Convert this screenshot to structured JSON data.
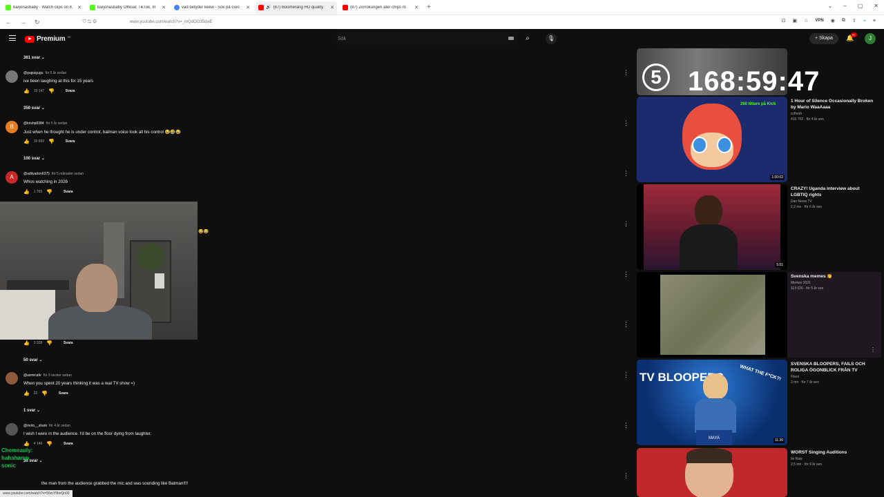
{
  "browser": {
    "tabs": [
      {
        "label": "barjonasbaby - Watch clips on K",
        "fav": "#53fc18"
      },
      {
        "label": "barjonasbaby Official: TikTok, In",
        "fav": "#53fc18"
      },
      {
        "label": "vad betyder kekw - Sök på Goo",
        "fav": "#4285f4"
      },
      {
        "label": "(87) Boomerang HD quality",
        "fav": "#ff0000"
      },
      {
        "label": "(87) Zorrokungen äter chips m",
        "fav": "#ff0000"
      }
    ],
    "url": "www.youtube.com/watch?v=_mQdOO35dwE",
    "vpn": "VPN"
  },
  "header": {
    "logo": "Premium",
    "region": "SE",
    "search_placeholder": "Sök",
    "create_label": "Skapa",
    "notif_count": "9+",
    "avatar_letter": "J"
  },
  "comments": {
    "reply_label": "Svara",
    "items": [
      {
        "replies": "361 svar"
      },
      {
        "author": "@guguigugu",
        "time": "för 5 år sedan",
        "text": "ive been laughing at this for 15 years",
        "likes": "19 147",
        "replies": "350 svar",
        "avatar_letter": ""
      },
      {
        "author": "@krishp8384",
        "time": "för 5 år sedan",
        "text": "Just when he thought he is under control, batman voice took all his control 😂🤣😂",
        "likes": "10 693",
        "replies": "100 svar",
        "avatar_letter": "B"
      },
      {
        "author": "@adityadon6375",
        "time": "för 5 månader sedan",
        "text": "Whos watching in 2026",
        "likes": "1 765",
        "avatar_letter": "A"
      },
      {
        "likes": "3 338",
        "replies": "50 svar"
      },
      {
        "author": "@asmrcafe",
        "time": "för 3 veckor sedan",
        "text": "When you spent 20 years thinking it was a real TV show =)",
        "likes": "22",
        "replies": "1 svar"
      },
      {
        "author": "@moto__shark",
        "time": "för 4 år sedan",
        "text": "I wish I were in the audience. I'd be on the floor dying from laughter.",
        "likes": "4 146",
        "replies": "36 svar"
      },
      {
        "text": "the man from the audience grabbed the mic and was sounding like Batman!!!!"
      }
    ]
  },
  "chat": [
    {
      "text": "Chemeauly:",
      "color": "#00c853"
    },
    {
      "text": "hahahamp",
      "color": "#00c853"
    },
    {
      "text": "sonic",
      "color": "#00c853"
    }
  ],
  "status_url": "www.youtube.com/watch?v=55mY9bvQn00",
  "sidebar": {
    "items": [
      {
        "title": "1 Hour of Silence Occasionally Broken by Mario WaaAaaa",
        "channel": "ccfresh",
        "stats": "415 702 · för 4 år sen",
        "duration": "1:00:02",
        "overlay": "168:59:47",
        "overlay_badge": "5",
        "kick_text": "260 tittare på Kick"
      },
      {
        "title": "CRAZY! Uganda interview about LGBTIQ rights",
        "channel": "Dan News TV",
        "stats": "2,2 mn · för 6 år sen",
        "duration": "5:51"
      },
      {
        "title": "Svenska memes 👏",
        "channel": "Memes 2021",
        "stats": "113 026 · för 5 år sen",
        "duration": ""
      },
      {
        "title": "SVENSKA BLOOPERS, FAILS OCH ROLIGA ÖGONBLICK FRÅN TV",
        "channel": "Flaze",
        "stats": "2 mn · för 7 år sen",
        "duration": "11:30",
        "overlay": "TV BLOOPERS",
        "overlay2": "WHAT THE F*CK?!",
        "podium": "MAYA"
      },
      {
        "title": "WORST Singing Auditions",
        "channel": "Its Raw",
        "stats": "2,5 mn · för 9 år sen",
        "duration": ""
      }
    ]
  }
}
